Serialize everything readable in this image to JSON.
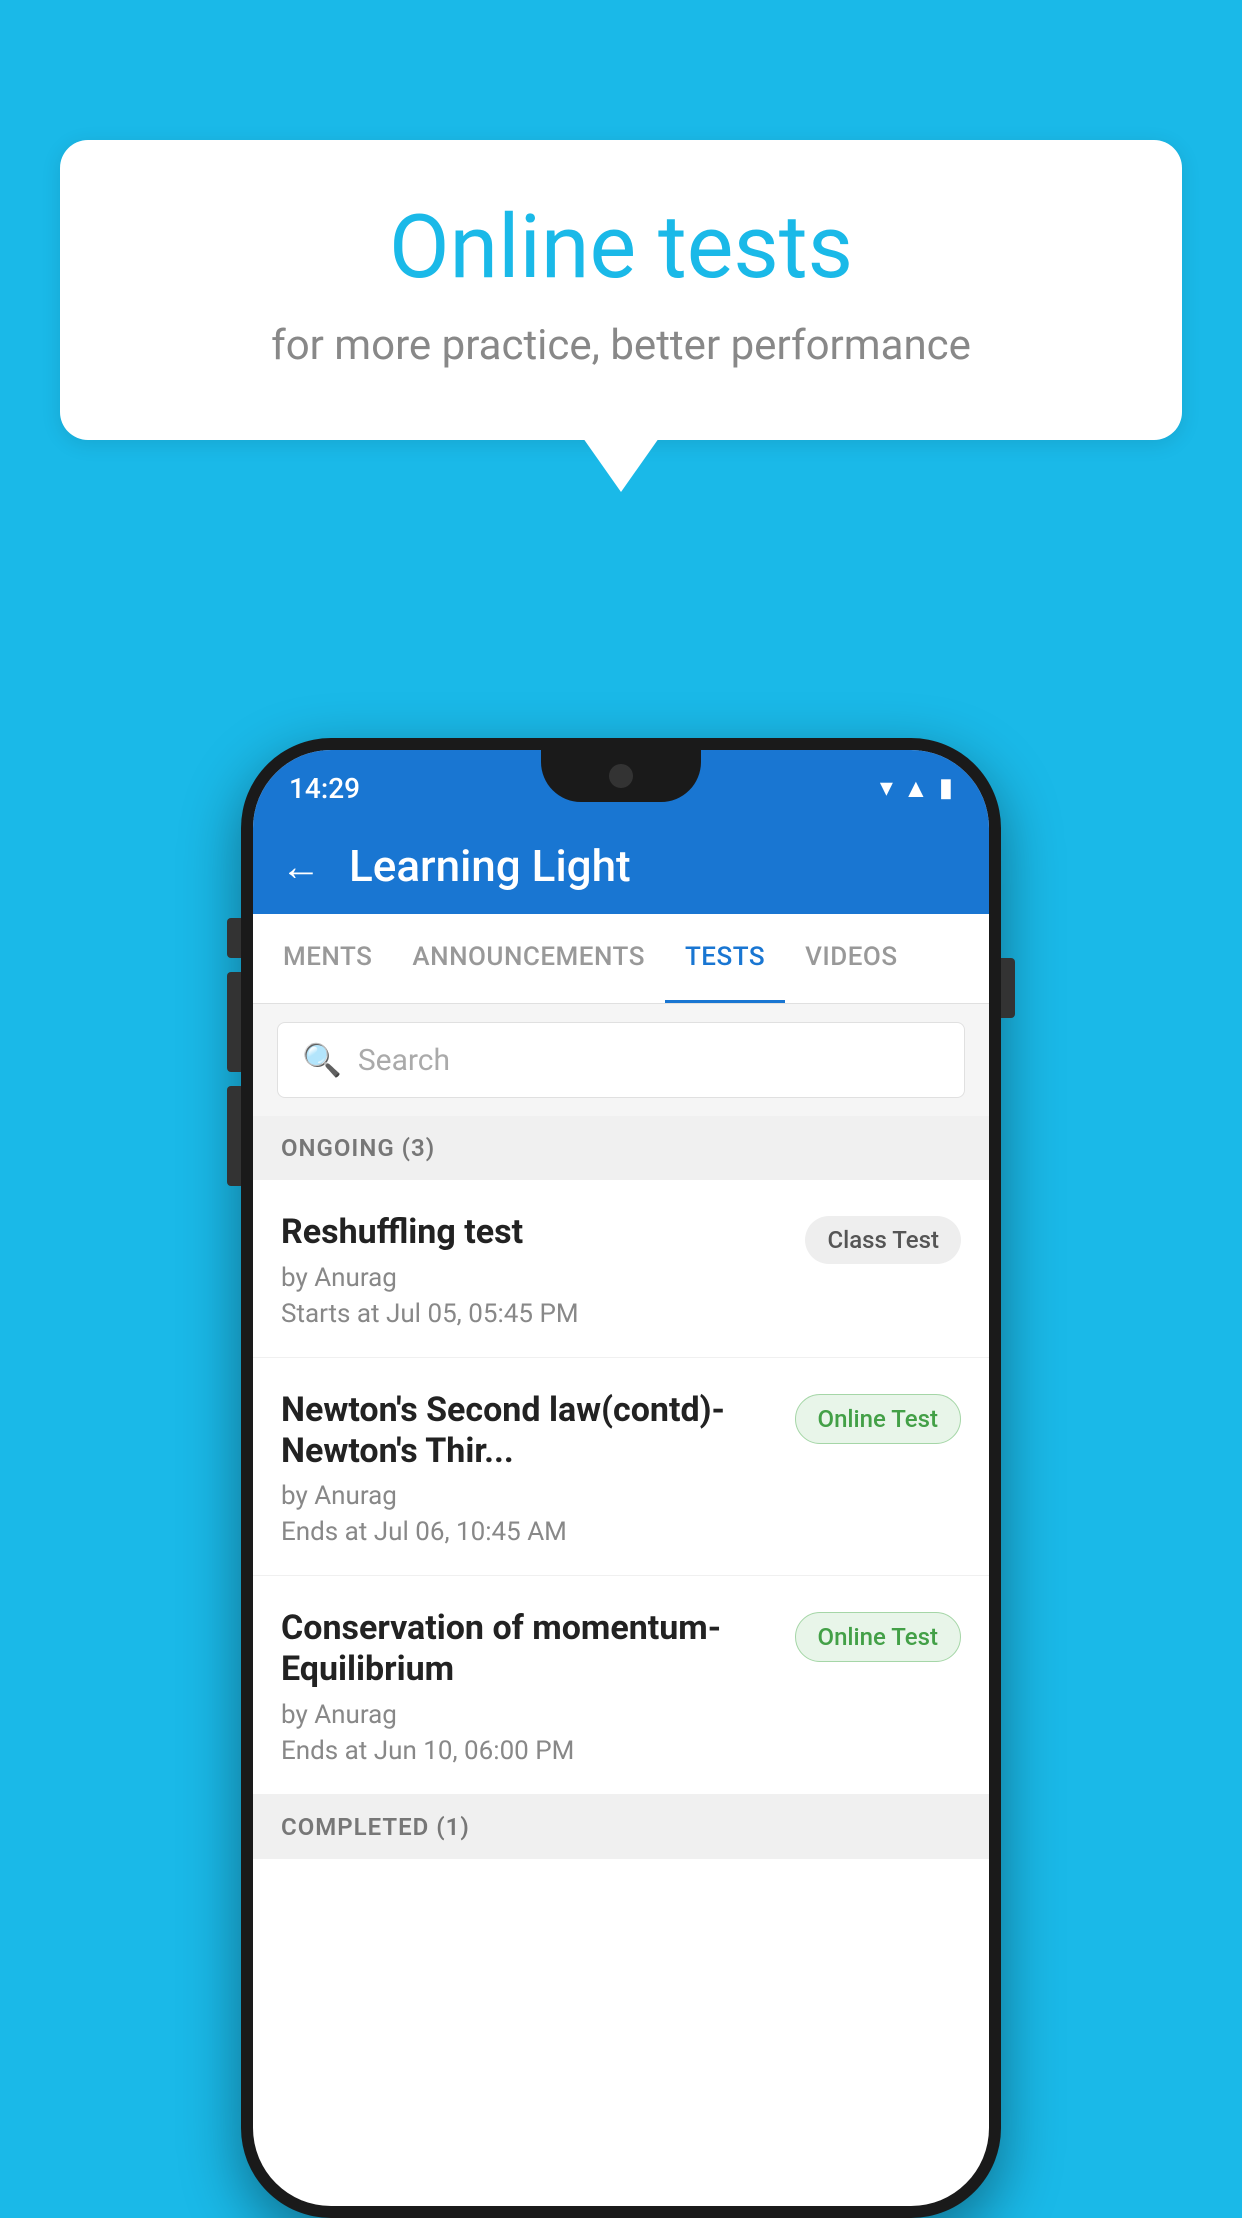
{
  "background_color": "#1ab9e8",
  "bubble": {
    "title": "Online tests",
    "subtitle": "for more practice, better performance"
  },
  "phone": {
    "status_bar": {
      "time": "14:29",
      "icons": [
        "wifi",
        "signal",
        "battery"
      ]
    },
    "app_bar": {
      "back_label": "←",
      "title": "Learning Light"
    },
    "tabs": [
      {
        "label": "MENTS",
        "active": false
      },
      {
        "label": "ANNOUNCEMENTS",
        "active": false
      },
      {
        "label": "TESTS",
        "active": true
      },
      {
        "label": "VIDEOS",
        "active": false
      }
    ],
    "search": {
      "placeholder": "Search"
    },
    "ongoing_section": {
      "label": "ONGOING (3)"
    },
    "tests": [
      {
        "name": "Reshuffling test",
        "by": "by Anurag",
        "date": "Starts at  Jul 05, 05:45 PM",
        "badge": "Class Test",
        "badge_type": "class"
      },
      {
        "name": "Newton's Second law(contd)-Newton's Thir...",
        "by": "by Anurag",
        "date": "Ends at  Jul 06, 10:45 AM",
        "badge": "Online Test",
        "badge_type": "online"
      },
      {
        "name": "Conservation of momentum-Equilibrium",
        "by": "by Anurag",
        "date": "Ends at  Jun 10, 06:00 PM",
        "badge": "Online Test",
        "badge_type": "online"
      }
    ],
    "completed_section": {
      "label": "COMPLETED (1)"
    }
  }
}
